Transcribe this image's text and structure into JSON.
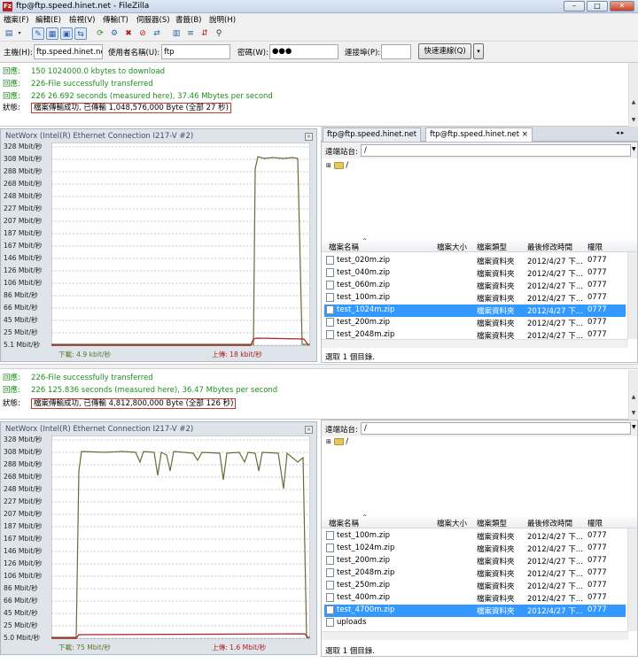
{
  "window": {
    "title": "ftp@ftp.speed.hinet.net - FileZilla",
    "app_icon": "Fz"
  },
  "menu": [
    "檔案(F)",
    "編輯(E)",
    "檢視(V)",
    "傳輸(T)",
    "伺服器(S)",
    "書籤(B)",
    "說明(H)"
  ],
  "quickconnect": {
    "host_label": "主機(H):",
    "host_value": "ftp.speed.hinet.net",
    "user_label": "使用者名稱(U):",
    "user_value": "ftp",
    "pass_label": "密碼(W):",
    "pass_value": "●●●",
    "port_label": "連接埠(P):",
    "port_value": "",
    "connect_button": "快速連線(Q)",
    "dropdown_arrow": "▾"
  },
  "log1": [
    {
      "key": "回應:",
      "text": "150 1024000.0 kbytes to download",
      "kind": "green"
    },
    {
      "key": "回應:",
      "text": "226-File successfully transferred",
      "kind": "green"
    },
    {
      "key": "回應:",
      "text": "226 26.692 seconds (measured here), 37.46 Mbytes per second",
      "kind": "green"
    },
    {
      "key": "狀態:",
      "text": "檔案傳輸成功, 已傳輸 1,048,576,000 Byte (全部 27 秒)",
      "kind": "boxed"
    }
  ],
  "log2": [
    {
      "key": "回應:",
      "text": "226-File successfully transferred",
      "kind": "green"
    },
    {
      "key": "回應:",
      "text": "226 125.836 seconds (measured here), 36.47 Mbytes per second",
      "kind": "green"
    },
    {
      "key": "狀態:",
      "text": "檔案傳輸成功, 已傳輸 4,812,800,000 Byte (全部 126 秒)",
      "kind": "boxed"
    }
  ],
  "networx1": {
    "title": "NetWorx (Intel(R) Ethernet Connection I217-V #2)",
    "close": "×",
    "ylabels": [
      "328 Mbit/秒",
      "308 Mbit/秒",
      "288 Mbit/秒",
      "268 Mbit/秒",
      "248 Mbit/秒",
      "227 Mbit/秒",
      "207 Mbit/秒",
      "187 Mbit/秒",
      "167 Mbit/秒",
      "146 Mbit/秒",
      "126 Mbit/秒",
      "106 Mbit/秒",
      "86 Mbit/秒",
      "66 Mbit/秒",
      "45 Mbit/秒",
      "25 Mbit/秒",
      "5.1 Mbit/秒"
    ],
    "download": "下載: 4.9 kbit/秒",
    "upload": "上傳: 18 kbit/秒"
  },
  "networx2": {
    "title": "NetWorx (Intel(R) Ethernet Connection I217-V #2)",
    "close": "×",
    "ylabels": [
      "328 Mbit/秒",
      "308 Mbit/秒",
      "288 Mbit/秒",
      "268 Mbit/秒",
      "248 Mbit/秒",
      "227 Mbit/秒",
      "207 Mbit/秒",
      "187 Mbit/秒",
      "167 Mbit/秒",
      "146 Mbit/秒",
      "126 Mbit/秒",
      "106 Mbit/秒",
      "86 Mbit/秒",
      "66 Mbit/秒",
      "45 Mbit/秒",
      "25 Mbit/秒",
      "5.0 Mbit/秒"
    ],
    "download": "下載: 75 Mbit/秒",
    "upload": "上傳: 1.6 Mbit/秒"
  },
  "tabs": [
    "ftp@ftp.speed.hinet.net",
    "ftp@ftp.speed.hinet.net"
  ],
  "tab_close": "×",
  "remote": {
    "site_label": "遠端站台:",
    "path": "/",
    "tree_root": "/",
    "columns": [
      "檔案名稱",
      "檔案大小",
      "檔案類型",
      "最後修改時間",
      "權限"
    ],
    "status": "選取 1 個目錄."
  },
  "files1": [
    {
      "name": "test_020m.zip",
      "type": "檔案資料夾",
      "date": "2012/4/27 下...",
      "perm": "0777",
      "selected": false
    },
    {
      "name": "test_040m.zip",
      "type": "檔案資料夾",
      "date": "2012/4/27 下...",
      "perm": "0777",
      "selected": false
    },
    {
      "name": "test_060m.zip",
      "type": "檔案資料夾",
      "date": "2012/4/27 下...",
      "perm": "0777",
      "selected": false
    },
    {
      "name": "test_100m.zip",
      "type": "檔案資料夾",
      "date": "2012/4/27 下...",
      "perm": "0777",
      "selected": false
    },
    {
      "name": "test_1024m.zip",
      "type": "檔案資料夾",
      "date": "2012/4/27 下...",
      "perm": "0777",
      "selected": true
    },
    {
      "name": "test_200m.zip",
      "type": "檔案資料夾",
      "date": "2012/4/27 下...",
      "perm": "0777",
      "selected": false
    },
    {
      "name": "test_2048m.zip",
      "type": "檔案資料夾",
      "date": "2012/4/27 下...",
      "perm": "0777",
      "selected": false
    }
  ],
  "files2": [
    {
      "name": "test_100m.zip",
      "type": "檔案資料夾",
      "date": "2012/4/27 下...",
      "perm": "0777",
      "selected": false
    },
    {
      "name": "test_1024m.zip",
      "type": "檔案資料夾",
      "date": "2012/4/27 下...",
      "perm": "0777",
      "selected": false
    },
    {
      "name": "test_200m.zip",
      "type": "檔案資料夾",
      "date": "2012/4/27 下...",
      "perm": "0777",
      "selected": false
    },
    {
      "name": "test_2048m.zip",
      "type": "檔案資料夾",
      "date": "2012/4/27 下...",
      "perm": "0777",
      "selected": false
    },
    {
      "name": "test_250m.zip",
      "type": "檔案資料夾",
      "date": "2012/4/27 下...",
      "perm": "0777",
      "selected": false
    },
    {
      "name": "test_400m.zip",
      "type": "檔案資料夾",
      "date": "2012/4/27 下...",
      "perm": "0777",
      "selected": false
    },
    {
      "name": "test_4700m.zip",
      "type": "檔案資料夾",
      "date": "2012/4/27 下...",
      "perm": "0777",
      "selected": true
    },
    {
      "name": "uploads",
      "type": "",
      "date": "",
      "perm": "",
      "selected": false
    }
  ],
  "colors": {
    "selection": "#3399ff",
    "log_green": "#1d8f1d",
    "highlight_box": "#c0392b",
    "download_line": "#6b6b3a",
    "upload_line": "#b02020"
  }
}
